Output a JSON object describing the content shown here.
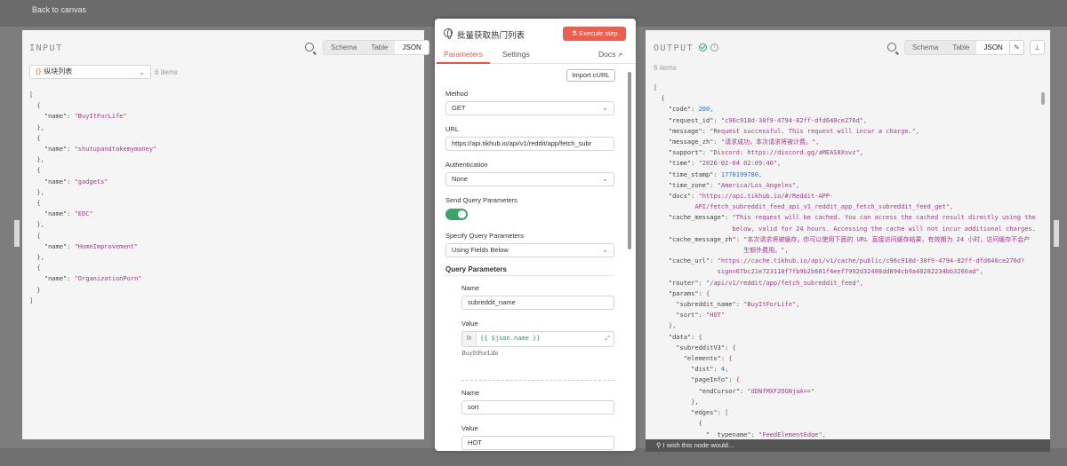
{
  "backdrop": {
    "back_label": "Back to canvas"
  },
  "input_panel": {
    "title": "INPUT",
    "view_tabs": [
      "Schema",
      "Table",
      "JSON"
    ],
    "active_view": "JSON",
    "selector": {
      "braces": "{}",
      "label": "纵块列表"
    },
    "item_count": "6 items",
    "json_lines": [
      "[",
      "  {",
      "    \"name\": \"BuyItForLife\"",
      "  },",
      "  {",
      "    \"name\": \"shutupandtakemymoney\"",
      "  },",
      "  {",
      "    \"name\": \"gadgets\"",
      "  },",
      "  {",
      "    \"name\": \"EDC\"",
      "  },",
      "  {",
      "    \"name\": \"HomeImprovement\"",
      "  },",
      "  {",
      "    \"name\": \"OrganizationPorn\"",
      "  }",
      "]"
    ]
  },
  "node": {
    "title": "批量获取热门列表",
    "execute_label": "Execute step",
    "tabs": {
      "parameters": "Parameters",
      "settings": "Settings",
      "docs": "Docs"
    },
    "import_curl": "Import cURL",
    "method": {
      "label": "Method",
      "value": "GET"
    },
    "url": {
      "label": "URL",
      "value": "https://api.tikhub.io/api/v1/reddit/app/fetch_subr"
    },
    "authentication": {
      "label": "Authentication",
      "value": "None"
    },
    "send_query": {
      "label": "Send Query Parameters"
    },
    "specify_query": {
      "label": "Specify Query Parameters",
      "value": "Using Fields Below"
    },
    "query_parameters_title": "Query Parameters",
    "param1": {
      "name_label": "Name",
      "name_value": "subreddit_name",
      "value_label": "Value",
      "fx": "fx",
      "expression": "{{ $json.name }}",
      "result": "BuyItForLife"
    },
    "param2": {
      "name_label": "Name",
      "name_value": "sort",
      "value_label": "Value",
      "value": "HOT"
    }
  },
  "output_panel": {
    "title": "OUTPUT",
    "view_tabs": [
      "Schema",
      "Table",
      "JSON"
    ],
    "active_view": "JSON",
    "item_count": "6 items",
    "json_lines": [
      "[",
      "  {",
      "    \"code\": 200,",
      "    \"request_id\": \"c96c918d-30f9-4794-82ff-dfd640ce276d\",",
      "    \"message\": \"Request successful. This request will incur a charge.\",",
      "    \"message_zh\": \"请求成功，本次请求将被计费。\",",
      "    \"support\": \"Discord: https://discord.gg/aMEAS8Xsvz\",",
      "    \"time\": \"2026-02-04 02:09:40\",",
      "    \"time_stamp\": 1770199780,",
      "    \"time_zone\": \"America/Los_Angeles\",",
      "    \"docs\": \"https://api.tikhub.io/#/Reddit-APP-",
      "           API/fetch_subreddit_feed_api_v1_reddit_app_fetch_subreddit_feed_get\",",
      "    \"cache_message\": \"This request will be cached. You can access the cached result directly using the URL",
      "                     below, valid for 24 hours. Accessing the cache will not incur additional charges.\",",
      "    \"cache_message_zh\": \"本次请求将被缓存，你可以使用下面的 URL 直接访问缓存结果，有效期为 24 小时，访问缓存不会产",
      "                        生额外费用。\",",
      "    \"cache_url\": \"https://cache.tikhub.io/api/v1/cache/public/c96c918d-30f9-4794-82ff-dfd640ce276d?",
      "                 sign=67bc21e723118f7fb9b2b681f4eef7992d32408dd894cb9a40282234bb3266ad\",",
      "    \"router\": \"/api/v1/reddit/app/fetch_subreddit_feed\",",
      "    \"params\": {",
      "      \"subreddit_name\": \"BuyItForLife\",",
      "      \"sort\": \"HOT\"",
      "    },",
      "    \"data\": {",
      "      \"subredditV3\": {",
      "        \"elements\": {",
      "          \"dist\": 4,",
      "          \"pageInfo\": {",
      "            \"endCursor\": \"dDNfMXF2OGNjaA==\"",
      "          },",
      "          \"edges\": [",
      "            {",
      "              \"__typename\": \"FeedElementEdge\","
    ],
    "wish_text": "I wish this node would..."
  }
}
